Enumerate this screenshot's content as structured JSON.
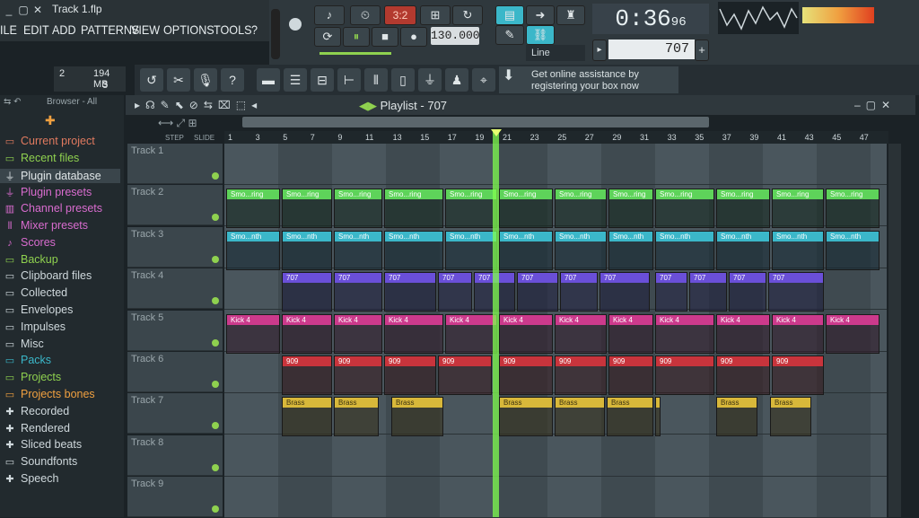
{
  "window": {
    "title": "Track 1.flp",
    "controls": [
      "_",
      "▢",
      "✕"
    ]
  },
  "menu": [
    "ILE",
    "EDIT",
    "ADD",
    "PATTERNS",
    "VIEW",
    "OPTIONS",
    "TOOLS",
    "?"
  ],
  "transport": {
    "song_mode": "3:2",
    "tempo": "130.000",
    "time": "0:36",
    "time_frac": "96",
    "snap": "Line",
    "pattern": "707",
    "hint_line1": "Get online assistance by",
    "hint_line2": "registering your box now"
  },
  "cpu": {
    "value": "2",
    "mem": "194 MB",
    "poly": "3"
  },
  "browser": {
    "header": "Browser - All",
    "items": [
      {
        "label": "Current project",
        "icon": "folder-icon",
        "color": "#e07a5f"
      },
      {
        "label": "Recent files",
        "icon": "folder-icon",
        "color": "#8fd14f"
      },
      {
        "label": "Plugin database",
        "icon": "plug-icon",
        "color": "#e0e6e8"
      },
      {
        "label": "Plugin presets",
        "icon": "plug-icon",
        "color": "#d96ccf"
      },
      {
        "label": "Channel presets",
        "icon": "channel-icon",
        "color": "#d96ccf"
      },
      {
        "label": "Mixer presets",
        "icon": "mixer-icon",
        "color": "#d96ccf"
      },
      {
        "label": "Scores",
        "icon": "note-icon",
        "color": "#d96ccf"
      },
      {
        "label": "Backup",
        "icon": "folder-icon",
        "color": "#8fd14f"
      },
      {
        "label": "Clipboard files",
        "icon": "folder-icon",
        "color": "#cfd8dc"
      },
      {
        "label": "Collected",
        "icon": "folder-icon",
        "color": "#cfd8dc"
      },
      {
        "label": "Envelopes",
        "icon": "folder-icon",
        "color": "#cfd8dc"
      },
      {
        "label": "Impulses",
        "icon": "folder-icon",
        "color": "#cfd8dc"
      },
      {
        "label": "Misc",
        "icon": "folder-icon",
        "color": "#cfd8dc"
      },
      {
        "label": "Packs",
        "icon": "folder-icon",
        "color": "#3bb7c9"
      },
      {
        "label": "Projects",
        "icon": "folder-icon",
        "color": "#8fd14f"
      },
      {
        "label": "Projects bones",
        "icon": "folder-icon",
        "color": "#f0a040"
      },
      {
        "label": "Recorded",
        "icon": "recorded-icon",
        "color": "#cfd8dc"
      },
      {
        "label": "Rendered",
        "icon": "rendered-icon",
        "color": "#cfd8dc"
      },
      {
        "label": "Sliced beats",
        "icon": "sliced-icon",
        "color": "#cfd8dc"
      },
      {
        "label": "Soundfonts",
        "icon": "folder-icon",
        "color": "#cfd8dc"
      },
      {
        "label": "Speech",
        "icon": "speech-icon",
        "color": "#cfd8dc"
      }
    ]
  },
  "playlist": {
    "title": "Playlist - 707",
    "step_label": "STEP",
    "slide_label": "SLIDE",
    "ruler": [
      "1",
      "3",
      "5",
      "7",
      "9",
      "11",
      "13",
      "15",
      "17",
      "19",
      "21",
      "23",
      "25",
      "27",
      "29",
      "31",
      "33",
      "35",
      "37",
      "39",
      "41",
      "43",
      "45",
      "47"
    ],
    "tracks": [
      "Track 1",
      "Track 2",
      "Track 3",
      "Track 4",
      "Track 5",
      "Track 6",
      "Track 7",
      "Track 8",
      "Track 9"
    ],
    "clip_labels": {
      "track2": "Smo...ring",
      "track3": "Smo...nth",
      "track4": "707",
      "track5": "Kick 4",
      "track6": "909",
      "track7": "Brass"
    }
  },
  "colors": {
    "green": "#5ed35a",
    "teal": "#3bb7c9",
    "purple": "#6a4fd8",
    "pink": "#cc3a8c",
    "red": "#c8343c",
    "yellow": "#d8b83a",
    "playhead": "#82ff50"
  }
}
